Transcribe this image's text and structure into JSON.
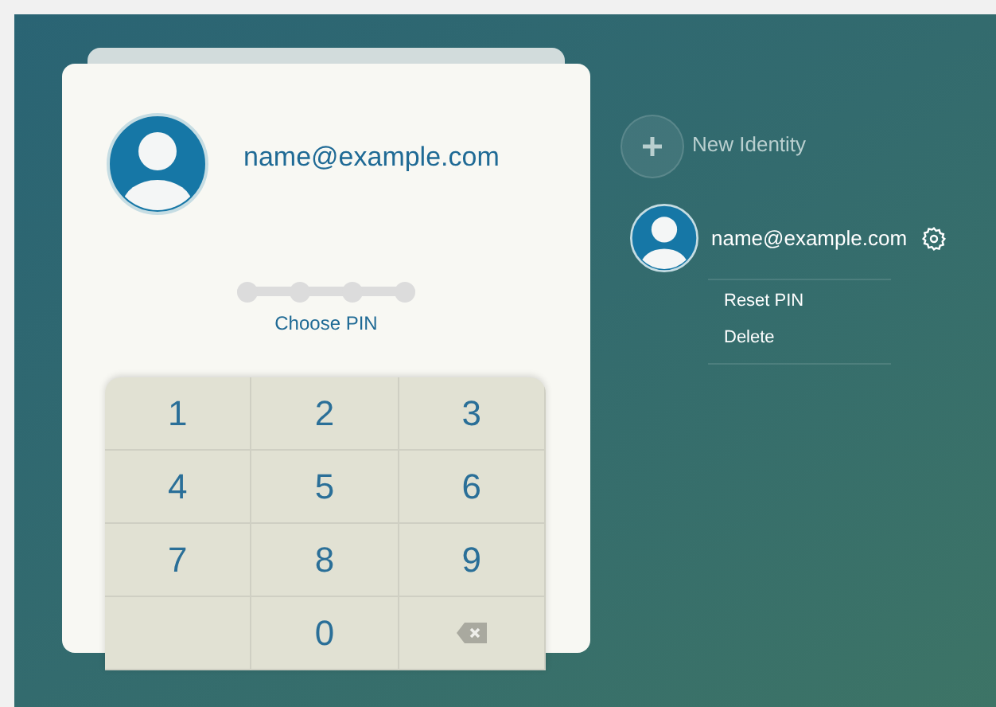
{
  "card": {
    "email": "name@example.com",
    "pin_dots": [
      {
        "filled": false
      },
      {
        "filled": false
      },
      {
        "filled": false
      },
      {
        "filled": false
      }
    ],
    "prompt": "Choose PIN",
    "keypad": [
      {
        "kind": "digit",
        "label": "1"
      },
      {
        "kind": "digit",
        "label": "2"
      },
      {
        "kind": "digit",
        "label": "3"
      },
      {
        "kind": "digit",
        "label": "4"
      },
      {
        "kind": "digit",
        "label": "5"
      },
      {
        "kind": "digit",
        "label": "6"
      },
      {
        "kind": "digit",
        "label": "7"
      },
      {
        "kind": "digit",
        "label": "8"
      },
      {
        "kind": "digit",
        "label": "9"
      },
      {
        "kind": "blank"
      },
      {
        "kind": "digit",
        "label": "0"
      },
      {
        "kind": "backspace"
      }
    ]
  },
  "sidebar": {
    "new_identity": "New Identity",
    "identities": [
      {
        "email": "name@example.com",
        "menu": [
          "Reset PIN",
          "Delete"
        ]
      }
    ]
  }
}
